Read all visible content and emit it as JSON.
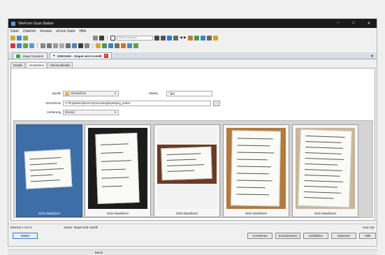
{
  "window": {
    "title": "TeleForm Scan Station"
  },
  "menu": [
    "Datei",
    "Zubehör",
    "Fenster",
    "eForm Suite",
    "Hilfe"
  ],
  "toolbar": {
    "zoom_label": "Vertikal anpassen"
  },
  "doc_tabs": [
    {
      "label": "Stapel Explorer"
    },
    {
      "label": "00001626 - Stapel wird erstellt"
    }
  ],
  "sub_tabs": [
    "Details",
    "Verarbeiten",
    "Elementdetails"
  ],
  "form": {
    "quelle_label": "Quelle",
    "quelle_value": "Verzeichnis",
    "maske_label": "Maske",
    "maske_value": "*.jpg",
    "verzeichnis_label": "Verzeichnis",
    "verzeichnis_value": "C:\\Projekte\\OpenCV\\processing\\input\\png_select",
    "browse_label": "...",
    "sortierung_label": "Sortierung",
    "sortierung_value": "(Keine)"
  },
  "thumbnails": [
    {
      "caption": "Nicht klassifiziert",
      "selected": true
    },
    {
      "caption": "Nicht klassifiziert",
      "selected": false
    },
    {
      "caption": "Nicht klassifiziert",
      "selected": false
    },
    {
      "caption": "Nicht klassifiziert",
      "selected": false
    },
    {
      "caption": "Nicht klassifiziert",
      "selected": false
    }
  ],
  "status": {
    "element": "Element 1 von 5",
    "stapel_status": "Status: Stapel wird erstellt",
    "scan_id": "Scan-QS"
  },
  "buttons": {
    "weiter": "Weiter",
    "annehmen": "Annehmen",
    "zuruecksetzen": "Zurücksetzen",
    "schliessen": "Schließen",
    "optionen": "Optionen",
    "hilfe": "Hilfe"
  },
  "bottom": {
    "status": "Bereit"
  },
  "colors": {
    "selected_thumb": "#3d6ea7",
    "gallery_bg": "#d4d4d4",
    "titlebar": "#1b1b1b"
  }
}
